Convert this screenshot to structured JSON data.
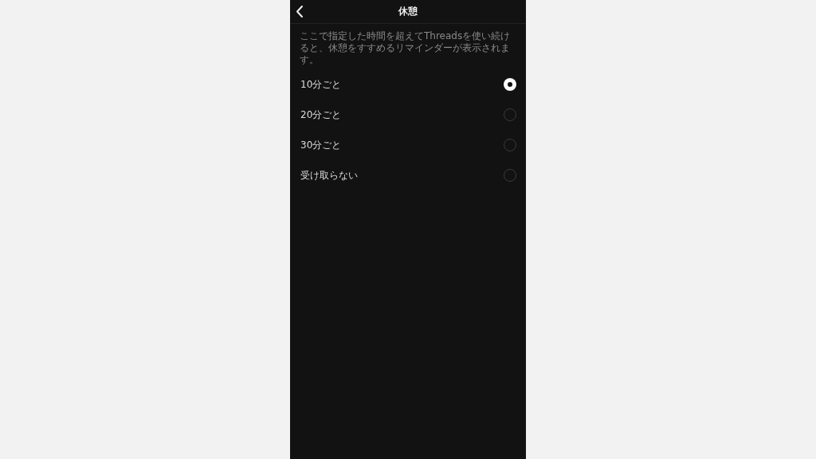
{
  "header": {
    "title": "休憩"
  },
  "description": "ここで指定した時間を超えてThreadsを使い続けると、休憩をすすめるリマインダーが表示されます。",
  "options": [
    {
      "label": "10分ごと",
      "selected": true
    },
    {
      "label": "20分ごと",
      "selected": false
    },
    {
      "label": "30分ごと",
      "selected": false
    },
    {
      "label": "受け取らない",
      "selected": false
    }
  ]
}
